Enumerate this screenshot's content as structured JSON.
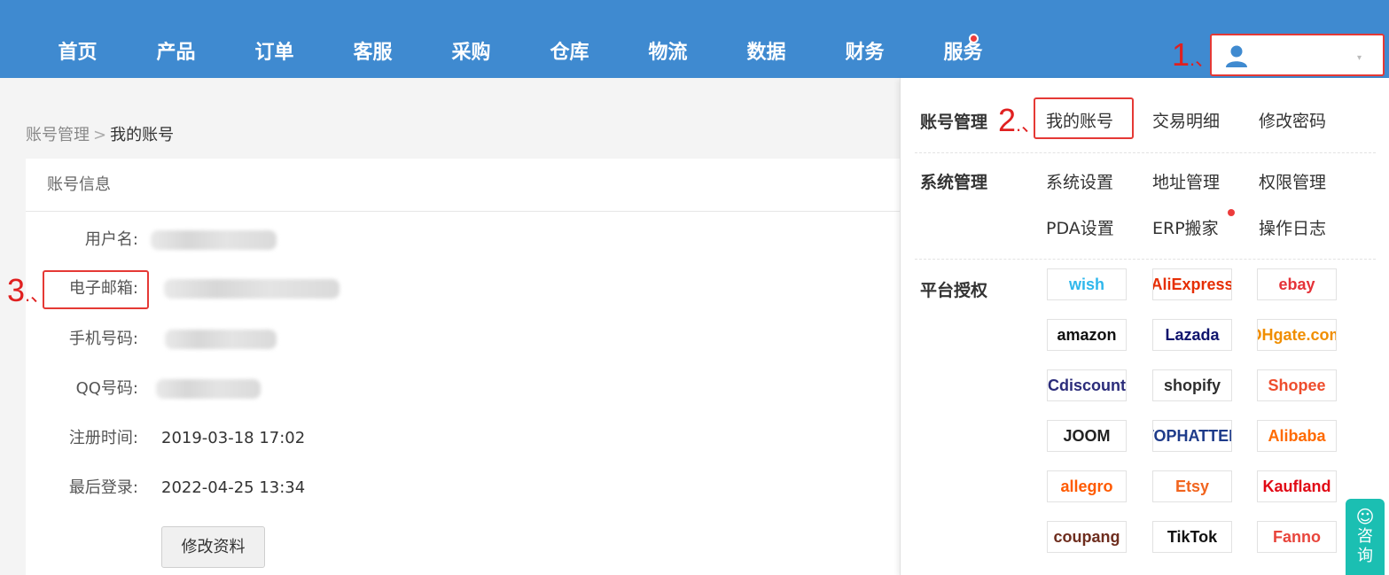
{
  "nav": {
    "items": [
      {
        "label": "首页"
      },
      {
        "label": "产品"
      },
      {
        "label": "订单"
      },
      {
        "label": "客服"
      },
      {
        "label": "采购"
      },
      {
        "label": "仓库"
      },
      {
        "label": "物流"
      },
      {
        "label": "数据"
      },
      {
        "label": "财务"
      },
      {
        "label": "服务"
      }
    ],
    "user_icon": "user-icon"
  },
  "annotations": {
    "one": "1",
    "two": "2",
    "three": "3",
    "suffix": "、"
  },
  "breadcrumb": {
    "parent": "账号管理",
    "separator": ">",
    "current": "我的账号"
  },
  "account": {
    "section_title": "账号信息",
    "fields": {
      "username_label": "用户名:",
      "email_label": "电子邮箱:",
      "phone_label": "手机号码:",
      "qq_label": "QQ号码:",
      "register_label": "注册时间:",
      "register_value": "2019-03-18 17:02",
      "lastlogin_label": "最后登录:",
      "lastlogin_value": "2022-04-25 13:34"
    },
    "edit_button": "修改资料"
  },
  "dropdown": {
    "account_mgmt": {
      "title": "账号管理",
      "links": [
        "我的账号",
        "交易明细",
        "修改密码"
      ]
    },
    "system_mgmt": {
      "title": "系统管理",
      "links": [
        "系统设置",
        "地址管理",
        "权限管理",
        "PDA设置",
        "ERP搬家",
        "操作日志"
      ]
    },
    "platform": {
      "title": "平台授权",
      "logos": [
        {
          "name": "wish",
          "color": "#2fb7ec"
        },
        {
          "name": "AliExpress",
          "color": "#e62e04"
        },
        {
          "name": "ebay",
          "color": "#e53238"
        },
        {
          "name": "amazon",
          "color": "#111111"
        },
        {
          "name": "Lazada",
          "color": "#0f146d"
        },
        {
          "name": "DHgate.com",
          "color": "#f08e00"
        },
        {
          "name": "Cdiscount",
          "color": "#2b2c7a"
        },
        {
          "name": "shopify",
          "color": "#2e2e2e"
        },
        {
          "name": "Shopee",
          "color": "#ee4d2d"
        },
        {
          "name": "JOOM",
          "color": "#222222"
        },
        {
          "name": "TOPHATTER",
          "color": "#1e3b8a"
        },
        {
          "name": "Alibaba",
          "color": "#ff6a00"
        },
        {
          "name": "allegro",
          "color": "#ff5a00"
        },
        {
          "name": "Etsy",
          "color": "#f1641e"
        },
        {
          "name": "Kaufland",
          "color": "#e10915"
        },
        {
          "name": "coupang",
          "color": "#6e2d1e"
        },
        {
          "name": "TikTok",
          "color": "#111111"
        },
        {
          "name": "Fanno",
          "color": "#e8453c"
        }
      ]
    }
  },
  "consult": {
    "label": "咨询",
    "icon": "headset-icon"
  }
}
